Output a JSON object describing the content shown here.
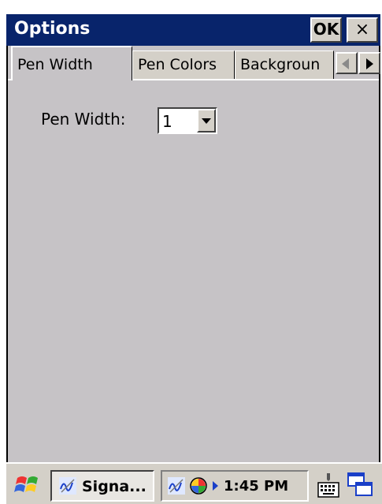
{
  "window": {
    "title": "Options",
    "ok_label": "OK",
    "close_label": "×"
  },
  "tabs": [
    {
      "label": "Pen Width",
      "active": true
    },
    {
      "label": "Pen Colors",
      "active": false
    },
    {
      "label": "Backgroun",
      "active": false
    }
  ],
  "pen_width": {
    "label": "Pen Width:",
    "value": "1"
  },
  "taskbar": {
    "task_label": "Signa...",
    "clock": "1:45 PM"
  },
  "colors": {
    "titlebar": "#08246b",
    "face": "#d4d0c8",
    "client": "#c6c3c6"
  },
  "icons": [
    "start-icon",
    "signature-app-icon",
    "color-wheel-icon",
    "keyboard-icon",
    "window-switch-icon",
    "scroll-left-icon",
    "scroll-right-icon",
    "dropdown-arrow-icon"
  ]
}
